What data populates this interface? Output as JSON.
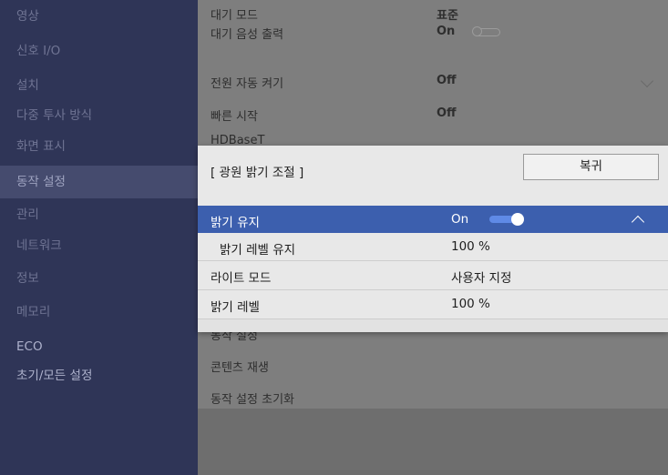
{
  "sidebar": {
    "items": [
      {
        "label": "영상"
      },
      {
        "label": "신호 I/O"
      },
      {
        "label": "설치"
      },
      {
        "label": "다중 투사 방식"
      },
      {
        "label": "화면 표시"
      },
      {
        "label": "동작 설정"
      },
      {
        "label": "관리"
      },
      {
        "label": "네트워크"
      },
      {
        "label": "정보"
      },
      {
        "label": "메모리"
      },
      {
        "label": "ECO"
      },
      {
        "label": "초기/모든 설정"
      }
    ],
    "selected": "동작 설정"
  },
  "background_menu": {
    "rows": [
      {
        "label": "대기 모드",
        "value": "표준"
      },
      {
        "label": "대기 음성 출력",
        "value": "On"
      },
      {
        "label": "전원 자동 켜기",
        "value": "Off"
      },
      {
        "label": "빠른 시작",
        "value": "Off"
      },
      {
        "label": "HDBaseT",
        "value": ""
      },
      {
        "label": "동작 설정",
        "value": ""
      },
      {
        "label": "콘텐츠 재생",
        "value": ""
      },
      {
        "label": "동작 설정 초기화",
        "value": ""
      }
    ]
  },
  "panel": {
    "title": "[ 광원 밝기 조절 ]",
    "reset_label": "복귀",
    "rows": [
      {
        "label": "밝기 유지",
        "value": "On",
        "toggle_on": true
      },
      {
        "label": "밝기 레벨 유지",
        "value": "100 %"
      },
      {
        "label": "라이트 모드",
        "value": "사용자 지정"
      },
      {
        "label": "밝기 레벨",
        "value": "100 %"
      }
    ]
  },
  "colors": {
    "sidebar_bg": "#2f3557",
    "selected_row": "#3c5fae",
    "toggle_track": "#5f8ae6",
    "panel_bg": "#e8e8e8"
  }
}
